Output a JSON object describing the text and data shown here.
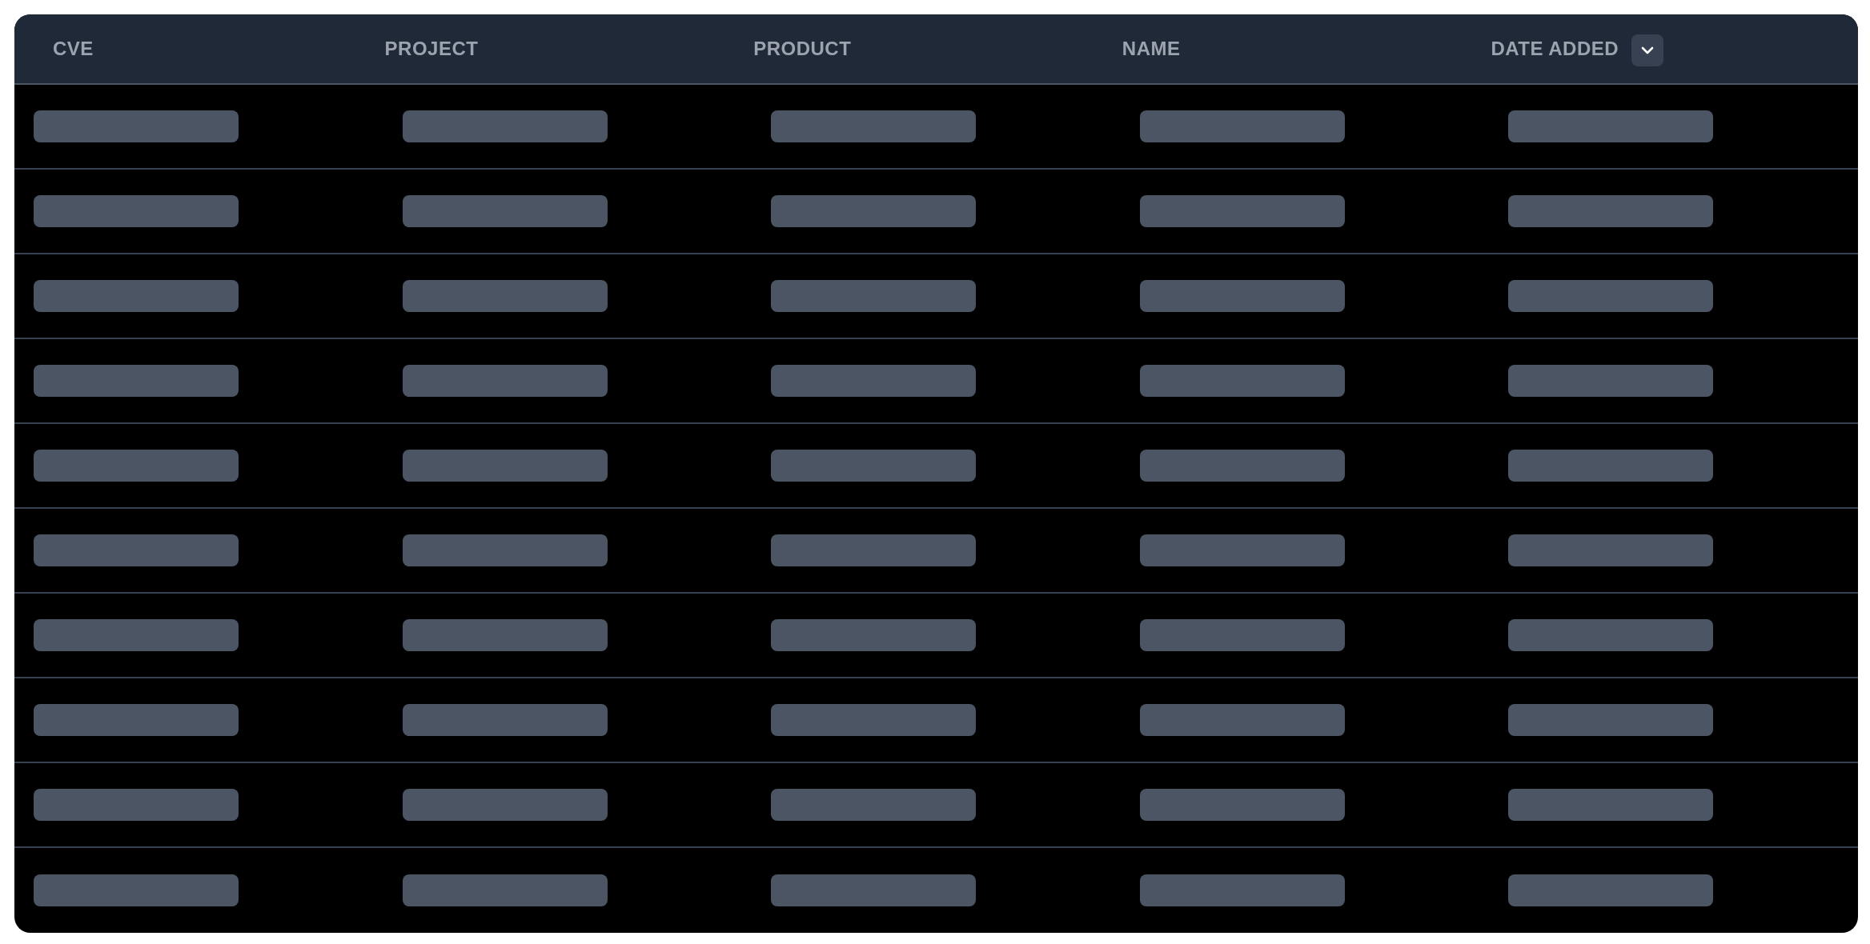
{
  "table": {
    "columns": [
      {
        "label": "CVE",
        "sorted": false
      },
      {
        "label": "PROJECT",
        "sorted": false
      },
      {
        "label": "PRODUCT",
        "sorted": false
      },
      {
        "label": "NAME",
        "sorted": false
      },
      {
        "label": "DATE ADDED",
        "sorted": true
      }
    ],
    "rows": [
      {
        "kind": "skeleton"
      },
      {
        "kind": "skeleton"
      },
      {
        "kind": "skeleton"
      },
      {
        "kind": "skeleton"
      },
      {
        "kind": "skeleton"
      },
      {
        "kind": "skeleton"
      },
      {
        "kind": "skeleton"
      },
      {
        "kind": "skeleton"
      },
      {
        "kind": "skeleton"
      },
      {
        "kind": "skeleton"
      }
    ]
  }
}
